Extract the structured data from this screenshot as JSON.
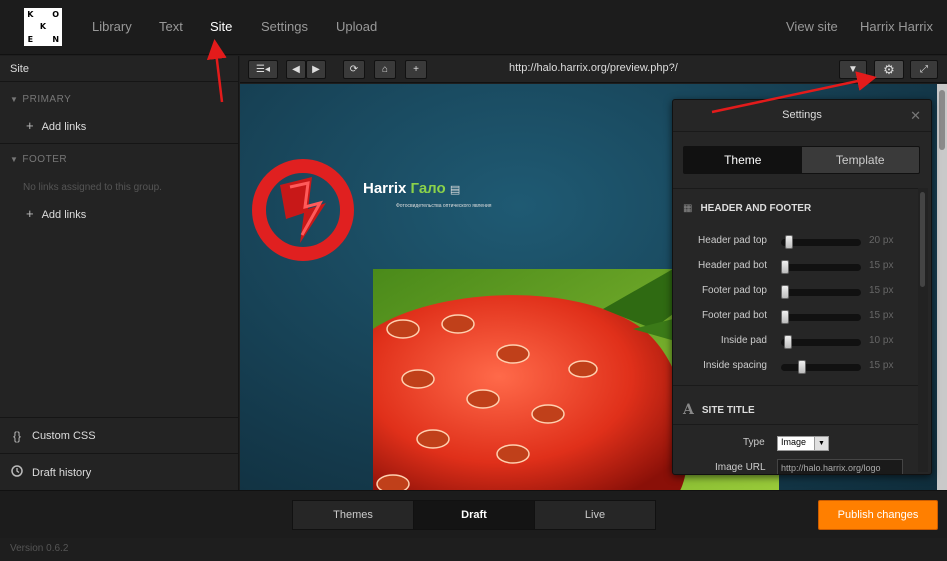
{
  "logo": {
    "letters": [
      "K",
      "",
      "O",
      "",
      "K",
      "",
      "E",
      "",
      "N"
    ]
  },
  "nav": {
    "library": "Library",
    "text": "Text",
    "site": "Site",
    "settings": "Settings",
    "upload": "Upload",
    "view_site": "View site",
    "user": "Harrix Harrix"
  },
  "sidebar": {
    "header": "Site",
    "primary_title": "PRIMARY",
    "primary_add": "Add links",
    "footer_title": "FOOTER",
    "footer_empty": "No links assigned to this group.",
    "footer_add": "Add links",
    "custom_css": "Custom CSS",
    "draft_history": "Draft history"
  },
  "toolbar": {
    "url": "http://halo.harrix.org/preview.php?/"
  },
  "preview": {
    "title_part1": "Harrix",
    "title_part2": "Гало",
    "subtitle": "Фотосвидетельства оптического явления"
  },
  "settings_panel": {
    "title": "Settings",
    "tab_theme": "Theme",
    "tab_template": "Template",
    "section1": "HEADER AND FOOTER",
    "sliders": [
      {
        "label": "Header pad top",
        "value": "20 px",
        "level": 20
      },
      {
        "label": "Header pad bot",
        "value": "15 px",
        "level": 15
      },
      {
        "label": "Footer pad top",
        "value": "15 px",
        "level": 15
      },
      {
        "label": "Footer pad bot",
        "value": "15 px",
        "level": 15
      },
      {
        "label": "Inside pad",
        "value": "10 px",
        "level": 10
      },
      {
        "label": "Inside spacing",
        "value": "15 px",
        "level": 15
      }
    ],
    "section2": "SITE TITLE",
    "type_label": "Type",
    "type_value": "Image",
    "image_url_label": "Image URL",
    "image_url_value": "http://halo.harrix.org/logo"
  },
  "bottom": {
    "themes": "Themes",
    "draft": "Draft",
    "live": "Live",
    "publish": "Publish changes"
  },
  "version": "Version 0.6.2",
  "colors": {
    "accent": "#ff7f00",
    "annotation_arrow": "#e31b1b"
  }
}
